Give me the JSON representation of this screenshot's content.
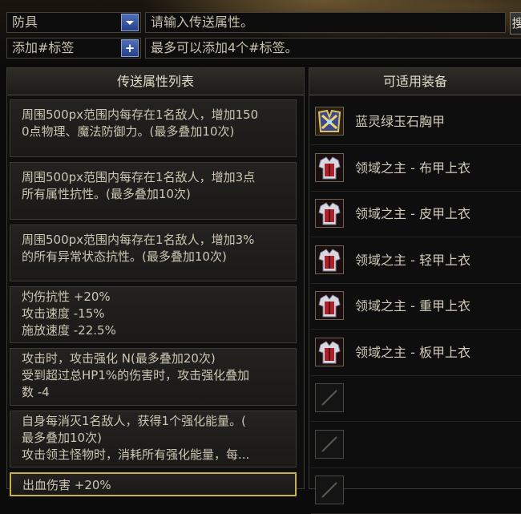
{
  "toolbar": {
    "category_select": "防具",
    "search_placeholder": "请输入传送属性。",
    "tag_field_label": "添加#标签",
    "tag_add_symbol": "+",
    "tag_hint": "最多可以添加4个#标签。",
    "search_button_label": "搜"
  },
  "attr_panel": {
    "title": "传送属性列表",
    "cards": [
      {
        "lines": [
          "周围500px范围内每存在1名敌人，增加150",
          "0点物理、魔法防御力。(最多叠加10次)"
        ]
      },
      {
        "lines": [
          "周围500px范围内每存在1名敌人，增加3点",
          "所有属性抗性。(最多叠加10次)"
        ]
      },
      {
        "lines": [
          "周围500px范围内每存在1名敌人，增加3%",
          "的所有异常状态抗性。(最多叠加10次)"
        ]
      },
      {
        "lines": [
          "灼伤抗性 +20%",
          "攻击速度 -15%",
          "施放速度 -22.5%"
        ]
      },
      {
        "lines": [
          "攻击时，攻击强化 N(最多叠加20次)",
          "受到超过总HP1%的伤害时，攻击强化叠加",
          "数 -4"
        ]
      },
      {
        "lines": [
          "自身每消灭1名敌人，获得1个强化能量。(",
          "最多叠加10次)",
          "攻击领主怪物时，消耗所有强化能量，每..."
        ]
      },
      {
        "lines": [
          "出血伤害 +20%"
        ]
      }
    ]
  },
  "equip_panel": {
    "title": "可适用装备",
    "items": [
      {
        "name": "蓝灵绿玉石胸甲",
        "icon": "breastplate-icon"
      },
      {
        "name": "领域之主 - 布甲上衣",
        "icon": "armor-top-icon"
      },
      {
        "name": "领域之主 - 皮甲上衣",
        "icon": "armor-top-icon"
      },
      {
        "name": "领域之主 - 轻甲上衣",
        "icon": "armor-top-icon"
      },
      {
        "name": "领域之主 - 重甲上衣",
        "icon": "armor-top-icon"
      },
      {
        "name": "领域之主 - 板甲上衣",
        "icon": "armor-top-icon"
      }
    ],
    "empty_slots": 3
  },
  "colors": {
    "accent_gold": "#c8b04a",
    "button_blue": "#3556a0",
    "text": "#cfc7b4"
  }
}
